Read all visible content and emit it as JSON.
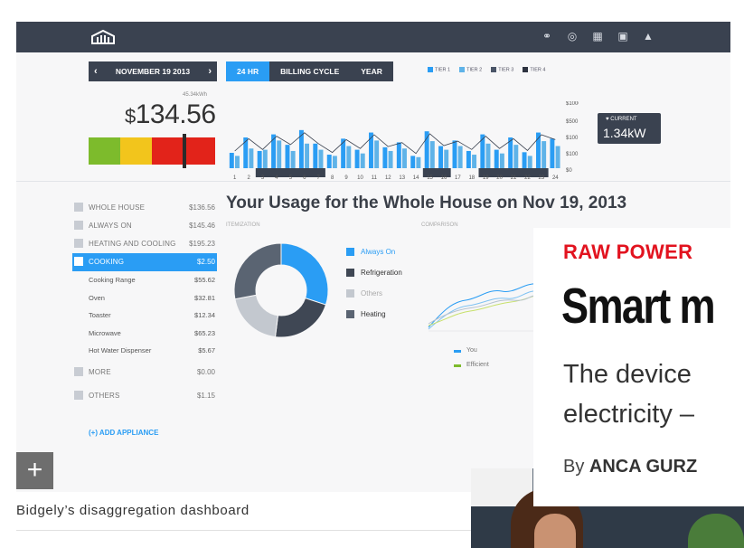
{
  "topbar": {
    "icons": [
      "link-icon",
      "globe-icon",
      "calendar-icon",
      "save-icon",
      "user-icon"
    ]
  },
  "date_nav": {
    "prev": "‹",
    "label": "NOVEMBER 19 2013",
    "next": "›"
  },
  "range_tabs": [
    "24 HR",
    "BILLING CYCLE",
    "YEAR"
  ],
  "tiers": [
    {
      "label": "TIER 1",
      "color": "#2a9df4"
    },
    {
      "label": "TIER 2",
      "color": "#5fb3e8"
    },
    {
      "label": "TIER 3",
      "color": "#4a5568"
    },
    {
      "label": "TIER 4",
      "color": "#2d3340"
    }
  ],
  "summary": {
    "kwh": "45.34kWh",
    "currency": "$",
    "amount": "134.56"
  },
  "meter_colors": [
    "#7dbb2c",
    "#f2c51c",
    "#e2231a",
    "#e2231a"
  ],
  "current": {
    "label": "♥ CURRENT",
    "value": "1.34kW"
  },
  "chart_data": {
    "type": "bar",
    "categories": [
      "1",
      "2",
      "3",
      "4",
      "5",
      "6",
      "7",
      "8",
      "9",
      "10",
      "11",
      "12",
      "13",
      "14",
      "15",
      "16",
      "17",
      "18",
      "19",
      "20",
      "21",
      "22",
      "23",
      "24"
    ],
    "series": [
      {
        "values": [
          25,
          50,
          28,
          55,
          38,
          62,
          40,
          22,
          48,
          30,
          58,
          34,
          42,
          20,
          60,
          36,
          45,
          28,
          55,
          30,
          50,
          26,
          58,
          48
        ]
      },
      {
        "values": [
          20,
          32,
          30,
          45,
          28,
          40,
          30,
          20,
          36,
          24,
          45,
          28,
          32,
          18,
          44,
          30,
          36,
          22,
          40,
          24,
          38,
          20,
          44,
          36
        ]
      }
    ],
    "y_ticks": [
      "$1000",
      "$500",
      "$100",
      "$100",
      "$0"
    ],
    "ylim": [
      0,
      100
    ]
  },
  "sidebar": {
    "items": [
      {
        "label": "WHOLE HOUSE",
        "value": "$136.56"
      },
      {
        "label": "ALWAYS ON",
        "value": "$145.46"
      },
      {
        "label": "HEATING AND COOLING",
        "value": "$195.23"
      },
      {
        "label": "COOKING",
        "value": "$2.50"
      }
    ],
    "sub_items": [
      {
        "label": "Cooking Range",
        "value": "$55.62"
      },
      {
        "label": "Oven",
        "value": "$32.81"
      },
      {
        "label": "Toaster",
        "value": "$12.34"
      },
      {
        "label": "Microwave",
        "value": "$65.23"
      },
      {
        "label": "Hot Water Dispenser",
        "value": "$5.67"
      }
    ],
    "more": {
      "label": "MORE",
      "value": "$0.00"
    },
    "others": {
      "label": "OTHERS",
      "value": "$1.15"
    },
    "add_label": "(+) ADD APPLIANCE"
  },
  "main": {
    "title": "Your Usage for the Whole House on Nov 19, 2013",
    "itemization_label": "ITEMIZATION",
    "comparison_label": "COMPARISON"
  },
  "donut": {
    "slices": [
      {
        "label": "Always On",
        "value": 30,
        "color": "#2a9df4"
      },
      {
        "label": "Refrigeration",
        "value": 22,
        "color": "#3f4754"
      },
      {
        "label": "Others",
        "value": 20,
        "color": "#c3c8cf"
      },
      {
        "label": "Heating",
        "value": 28,
        "color": "#5a6472"
      }
    ]
  },
  "compare_legend": [
    {
      "label": "You",
      "color": "#2a9df4"
    },
    {
      "label": "Efficient",
      "color": "#7dbb2c"
    }
  ],
  "caption": "Bidgely’s disaggregation dashboard",
  "article": {
    "kicker": "RAW POWER",
    "headline": "Smart m",
    "dek_line1": "The device",
    "dek_line2": "electricity –",
    "byline_prefix": "By ",
    "byline_name": "ANCA GURZ"
  }
}
